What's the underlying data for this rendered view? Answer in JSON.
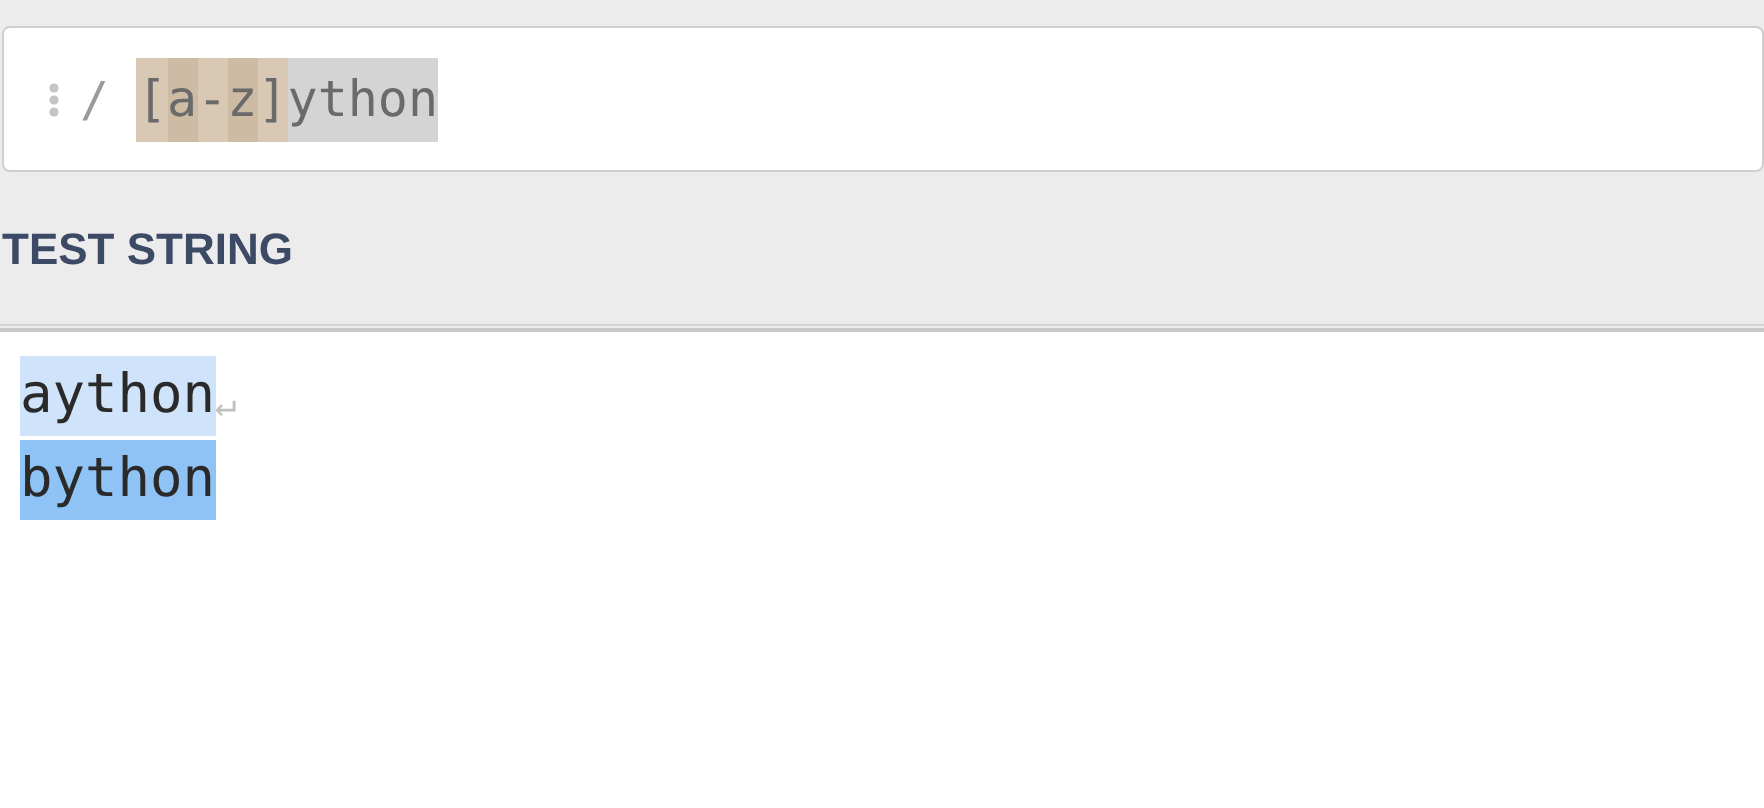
{
  "regex_field": {
    "delimiter": "/",
    "tokens": [
      {
        "text": "[",
        "kind": "class"
      },
      {
        "text": "a",
        "kind": "class_item"
      },
      {
        "text": "-",
        "kind": "class"
      },
      {
        "text": "z",
        "kind": "class_item"
      },
      {
        "text": "]",
        "kind": "class"
      },
      {
        "text": "ython",
        "kind": "literal"
      }
    ]
  },
  "test_string": {
    "title": "TEST STRING",
    "lines": [
      {
        "text": "aython",
        "kind": "even",
        "end_mark": "↵"
      },
      {
        "text": "bython",
        "kind": "odd"
      }
    ]
  }
}
